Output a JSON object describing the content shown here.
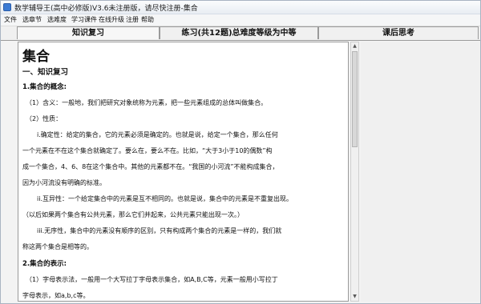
{
  "window": {
    "title": "数学辅导王(高中必修版)V3.6未注册版，请尽快注册-集合"
  },
  "menu": {
    "items": [
      "文件",
      "选章节",
      "选难度",
      "学习课件",
      "在线升级",
      "注册",
      "帮助"
    ]
  },
  "tabs": [
    {
      "label": "知识复习",
      "active": true
    },
    {
      "label": "练习(共12题)总难度等级为中等",
      "active": false
    },
    {
      "label": "课后思考",
      "active": false
    }
  ],
  "document": {
    "title": "集合",
    "section": "一、知识复习",
    "sub1": "1.集合的概念:",
    "p1": "（1）含义：一般地，我们把研究对象统称为元素，把一些元素组成的总体叫做集合。",
    "p2": "（2）性质：",
    "p3": "i.确定性：给定的集合，它的元素必须是确定的。也就是说，给定一个集合，那么任何",
    "p4": "一个元素在不在这个集合就确定了。要么在，要么不在。比如，“大于3小于10的偶数”构",
    "p5": "成一个集合，4、6、8在这个集合中。其他的元素都不在。“我国的小河流”不能构成集合，",
    "p6": "因为小河流没有明确的标准。",
    "p7": "ii.互异性：一个给定集合中的元素是互不相同的。也就是说，集合中的元素是不重复出现。",
    "p8": "（以后如果两个集合有公共元素，那么它们并起来，公共元素只能出现一次。）",
    "p9": "iii.无序性，集合中的元素没有顺序的区别，只有构成两个集合的元素是一样的，我们就",
    "p10": "称这两个集合是相等的。",
    "sub2": "2.集合的表示:",
    "p11": "（1）字母表示法，一般用一个大写拉丁字母表示集合，如A,B,C等，元素一般用小写拉丁",
    "p12": "字母表示，如a,b,c等。"
  }
}
